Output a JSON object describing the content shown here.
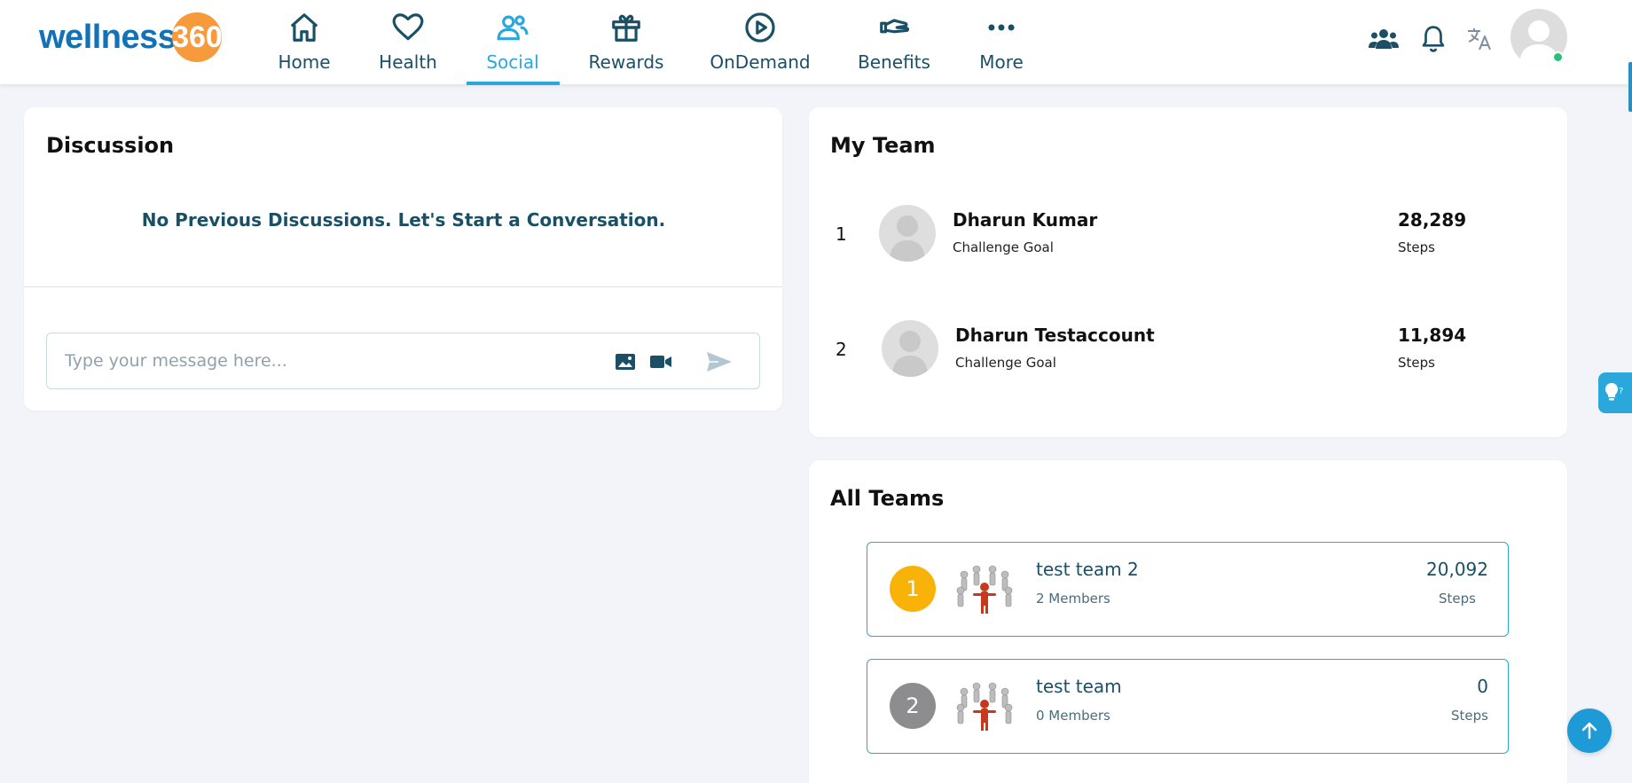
{
  "brand": {
    "logo_word": "wellness",
    "logo_number": "360"
  },
  "nav": {
    "items": [
      {
        "label": "Home",
        "icon": "home-icon"
      },
      {
        "label": "Health",
        "icon": "heart-icon"
      },
      {
        "label": "Social",
        "icon": "users-icon",
        "active": true
      },
      {
        "label": "Rewards",
        "icon": "gift-icon"
      },
      {
        "label": "OnDemand",
        "icon": "play-circle-icon"
      },
      {
        "label": "Benefits",
        "icon": "hand-icon"
      },
      {
        "label": "More",
        "icon": "more-dots-icon"
      }
    ]
  },
  "header_icons": [
    "team-icon",
    "bell-icon",
    "translate-icon",
    "avatar"
  ],
  "discussion": {
    "title": "Discussion",
    "empty_message": "No Previous Discussions. Let's Start a Conversation.",
    "input_placeholder": "Type your message here..."
  },
  "my_team": {
    "title": "My Team",
    "members": [
      {
        "rank": "1",
        "name": "Dharun Kumar",
        "subtitle": "Challenge Goal",
        "steps": "28,289",
        "steps_label": "Steps"
      },
      {
        "rank": "2",
        "name": "Dharun Testaccount",
        "subtitle": "Challenge Goal",
        "steps": "11,894",
        "steps_label": "Steps"
      }
    ]
  },
  "all_teams": {
    "title": "All Teams",
    "teams": [
      {
        "rank": "1",
        "name": "test team 2",
        "members": "2 Members",
        "steps": "20,092",
        "steps_label": "Steps",
        "rank_color": "#f9b208"
      },
      {
        "rank": "2",
        "name": "test team",
        "members": "0 Members",
        "steps": "0",
        "steps_label": "Steps",
        "rank_color": "#8d8d90"
      }
    ]
  },
  "colors": {
    "accent": "#2aa8db",
    "primary_text": "#1b4f66",
    "background": "#f3f4f9",
    "logo_blue": "#1272b8",
    "logo_orange": "#f79a3c"
  }
}
